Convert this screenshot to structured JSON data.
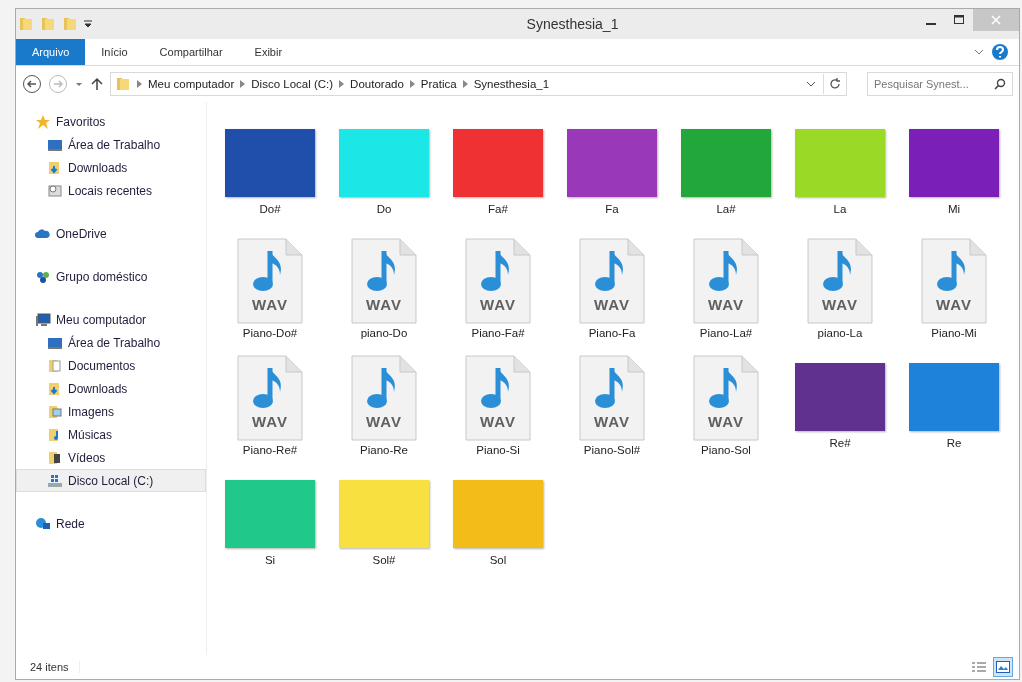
{
  "window": {
    "title": "Synesthesia_1"
  },
  "ribbon": {
    "tabs": [
      {
        "label": "Arquivo",
        "selected": true
      },
      {
        "label": "Início",
        "selected": false
      },
      {
        "label": "Compartilhar",
        "selected": false
      },
      {
        "label": "Exibir",
        "selected": false
      }
    ]
  },
  "address_bar": {
    "path": [
      "Meu computador",
      "Disco Local (C:)",
      "Doutorado",
      "Pratica",
      "Synesthesia_1"
    ]
  },
  "search": {
    "placeholder": "Pesquisar Synest..."
  },
  "sidebar": {
    "groups": [
      {
        "label": "Favoritos",
        "children": [
          {
            "label": "Área de Trabalho",
            "selected": false
          },
          {
            "label": "Downloads",
            "selected": false
          },
          {
            "label": "Locais recentes",
            "selected": false
          }
        ]
      },
      {
        "label": "OneDrive"
      },
      {
        "label": "Grupo doméstico"
      },
      {
        "label": "Meu computador",
        "children": [
          {
            "label": "Área de Trabalho",
            "selected": false
          },
          {
            "label": "Documentos",
            "selected": false
          },
          {
            "label": "Downloads",
            "selected": false
          },
          {
            "label": "Imagens",
            "selected": false
          },
          {
            "label": "Músicas",
            "selected": false
          },
          {
            "label": "Vídeos",
            "selected": false
          },
          {
            "label": "Disco Local (C:)",
            "selected": true
          }
        ]
      },
      {
        "label": "Rede"
      }
    ]
  },
  "files": [
    {
      "name": "Do#",
      "kind": "image",
      "color": "#1f4fab"
    },
    {
      "name": "Do",
      "kind": "image",
      "color": "#1ce6e6"
    },
    {
      "name": "Fa#",
      "kind": "image",
      "color": "#f03134"
    },
    {
      "name": "Fa",
      "kind": "image",
      "color": "#9a38ba"
    },
    {
      "name": "La#",
      "kind": "image",
      "color": "#22a83a"
    },
    {
      "name": "La",
      "kind": "image",
      "color": "#9ad925"
    },
    {
      "name": "Mi",
      "kind": "image",
      "color": "#7a1fb8"
    },
    {
      "name": "Piano-Do#",
      "kind": "wav",
      "label": "WAV"
    },
    {
      "name": "piano-Do",
      "kind": "wav",
      "label": "WAV"
    },
    {
      "name": "Piano-Fa#",
      "kind": "wav",
      "label": "WAV"
    },
    {
      "name": "Piano-Fa",
      "kind": "wav",
      "label": "WAV"
    },
    {
      "name": "Piano-La#",
      "kind": "wav",
      "label": "WAV"
    },
    {
      "name": "piano-La",
      "kind": "wav",
      "label": "WAV"
    },
    {
      "name": "Piano-Mi",
      "kind": "wav",
      "label": "WAV"
    },
    {
      "name": "Piano-Re#",
      "kind": "wav",
      "label": "WAV"
    },
    {
      "name": "Piano-Re",
      "kind": "wav",
      "label": "WAV"
    },
    {
      "name": "Piano-Si",
      "kind": "wav",
      "label": "WAV"
    },
    {
      "name": "Piano-Sol#",
      "kind": "wav",
      "label": "WAV"
    },
    {
      "name": "Piano-Sol",
      "kind": "wav",
      "label": "WAV"
    },
    {
      "name": "Re#",
      "kind": "image",
      "color": "#60318e"
    },
    {
      "name": "Re",
      "kind": "image",
      "color": "#1e82da"
    },
    {
      "name": "Si",
      "kind": "image",
      "color": "#20c98a"
    },
    {
      "name": "Sol#",
      "kind": "image",
      "color": "#f8e040"
    },
    {
      "name": "Sol",
      "kind": "image",
      "color": "#f3bd19"
    }
  ],
  "status_bar": {
    "count": "24 itens",
    "view_buttons": [
      {
        "selected": false
      },
      {
        "selected": true
      }
    ]
  }
}
